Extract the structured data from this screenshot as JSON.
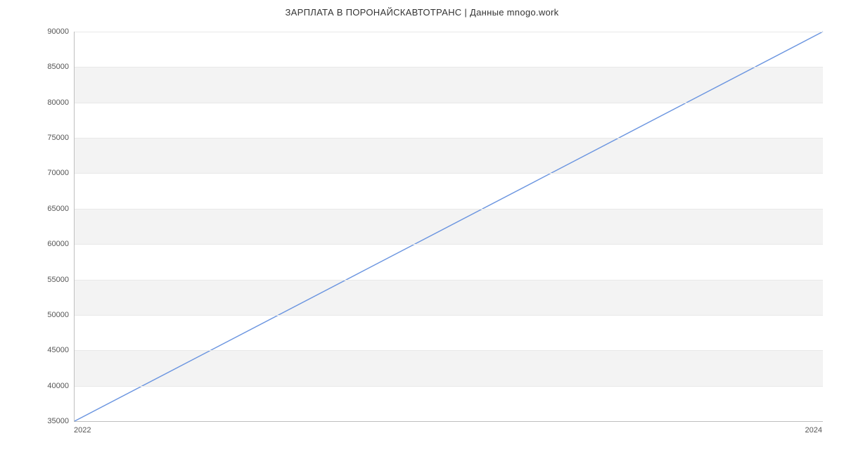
{
  "chart_data": {
    "type": "line",
    "title": "ЗАРПЛАТА В  ПОРОНАЙСКАВТОТРАНС | Данные mnogo.work",
    "xlabel": "",
    "ylabel": "",
    "x": [
      2022,
      2024
    ],
    "values": [
      35000,
      90000
    ],
    "x_ticks": [
      2022,
      2024
    ],
    "y_ticks": [
      35000,
      40000,
      45000,
      50000,
      55000,
      60000,
      65000,
      70000,
      75000,
      80000,
      85000,
      90000
    ],
    "xlim": [
      2022,
      2024
    ],
    "ylim": [
      35000,
      90000
    ],
    "line_color": "#6b95e0",
    "band_color": "#f3f3f3",
    "grid": true
  }
}
